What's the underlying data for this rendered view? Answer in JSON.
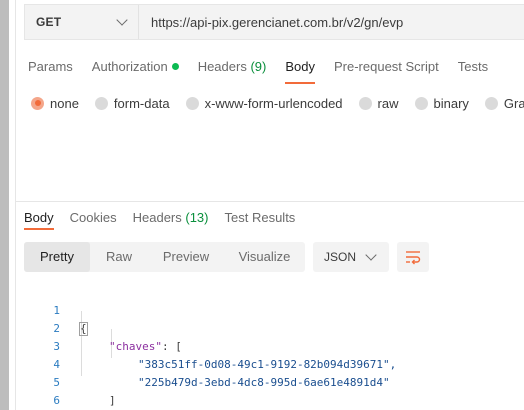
{
  "request": {
    "method": "GET",
    "url": "https://api-pix.gerencianet.com.br/v2/gn/evp"
  },
  "request_tabs": [
    {
      "label": "Params"
    },
    {
      "label": "Authorization"
    },
    {
      "label": "Headers",
      "count": "(9)"
    },
    {
      "label": "Body"
    },
    {
      "label": "Pre-request Script"
    },
    {
      "label": "Tests"
    }
  ],
  "body_types": [
    {
      "label": "none",
      "checked": true
    },
    {
      "label": "form-data"
    },
    {
      "label": "x-www-form-urlencoded"
    },
    {
      "label": "raw"
    },
    {
      "label": "binary"
    },
    {
      "label": "Grap"
    }
  ],
  "response_tabs": [
    {
      "label": "Body"
    },
    {
      "label": "Cookies"
    },
    {
      "label": "Headers",
      "count": "(13)"
    },
    {
      "label": "Test Results"
    }
  ],
  "view_modes": [
    "Pretty",
    "Raw",
    "Preview",
    "Visualize"
  ],
  "format": "JSON",
  "code": {
    "line_numbers": [
      "1",
      "2",
      "3",
      "4",
      "5",
      "6"
    ],
    "open_brace": "{",
    "key": "\"chaves\"",
    "colon_bracket": ": [",
    "values": [
      "\"383c51ff-0d08-49c1-9192-82b094d39671\",",
      "\"225b479d-3ebd-4dc8-995d-6ae61e4891d4\""
    ],
    "close_bracket": "]",
    "close_brace": "}"
  },
  "colors": {
    "accent": "#f26b3a",
    "auth_dot": "#0cbb52",
    "count_text": "#0a8f3c",
    "json_key": "#8c2fa0",
    "json_string": "#1a4e8f",
    "line_number": "#2a7bc0"
  }
}
